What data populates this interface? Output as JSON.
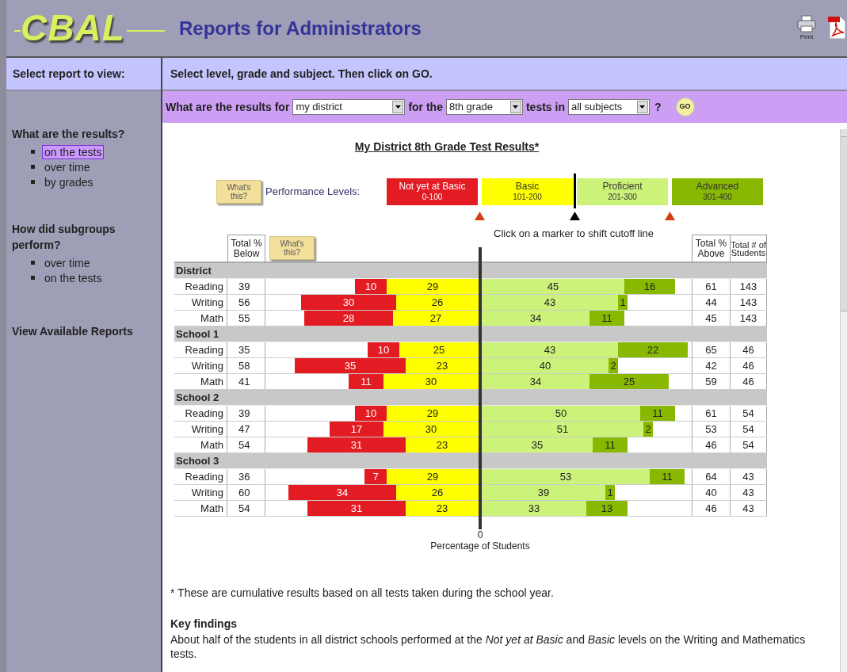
{
  "header": {
    "logo": "CBAL",
    "title": "Reports for Administrators",
    "print_label": "Print"
  },
  "sidebar": {
    "heading": "Select report to view:",
    "sections": [
      {
        "title": "What are the results?",
        "items": [
          {
            "label": "on the tests",
            "selected": true
          },
          {
            "label": "over time",
            "selected": false
          },
          {
            "label": "by grades",
            "selected": false
          }
        ]
      },
      {
        "title": "How did subgroups perform?",
        "items": [
          {
            "label": "over time",
            "selected": false
          },
          {
            "label": "on the tests",
            "selected": false
          }
        ]
      }
    ],
    "link": "View Available Reports"
  },
  "instruction": "Select level, grade and subject. Then click on GO.",
  "query": {
    "lead": "What are the results for",
    "level": "my district",
    "join_1": "for the",
    "grade": "8th grade",
    "join_2": "tests in",
    "subject": "all subjects",
    "end": "?",
    "go": "GO"
  },
  "report": {
    "title": "My District 8th Grade Test Results*",
    "whats_this": "What's this?",
    "levels_label": "Performance Levels:",
    "levels": [
      {
        "name": "Not yet at Basic",
        "range": "0-100",
        "color": "#e31b23"
      },
      {
        "name": "Basic",
        "range": "101-200",
        "color": "#ffff00"
      },
      {
        "name": "Proficient",
        "range": "201-300",
        "color": "#ccf27a"
      },
      {
        "name": "Advanced",
        "range": "301-400",
        "color": "#88b800"
      }
    ],
    "markers": [
      {
        "selected": false
      },
      {
        "selected": true
      },
      {
        "selected": false
      }
    ],
    "marker_hint": "Click on a marker to shift cutoff line",
    "columns": {
      "below": "Total % Below",
      "whats_this": "What's this?",
      "above": "Total % Above",
      "students": "Total # of Students"
    },
    "groups": [
      {
        "name": "District",
        "rows": [
          {
            "subject": "Reading",
            "below": "39",
            "segments": [
              "10",
              "29",
              "45",
              "16"
            ],
            "above": "61",
            "students": "143"
          },
          {
            "subject": "Writing",
            "below": "56",
            "segments": [
              "30",
              "26",
              "43",
              "1"
            ],
            "above": "44",
            "students": "143"
          },
          {
            "subject": "Math",
            "below": "55",
            "segments": [
              "28",
              "27",
              "34",
              "11"
            ],
            "above": "45",
            "students": "143"
          }
        ]
      },
      {
        "name": "School 1",
        "rows": [
          {
            "subject": "Reading",
            "below": "35",
            "segments": [
              "10",
              "25",
              "43",
              "22"
            ],
            "above": "65",
            "students": "46"
          },
          {
            "subject": "Writing",
            "below": "58",
            "segments": [
              "35",
              "23",
              "40",
              "2"
            ],
            "above": "42",
            "students": "46"
          },
          {
            "subject": "Math",
            "below": "41",
            "segments": [
              "11",
              "30",
              "34",
              "25"
            ],
            "above": "59",
            "students": "46"
          }
        ]
      },
      {
        "name": "School 2",
        "rows": [
          {
            "subject": "Reading",
            "below": "39",
            "segments": [
              "10",
              "29",
              "50",
              "11"
            ],
            "above": "61",
            "students": "54"
          },
          {
            "subject": "Writing",
            "below": "47",
            "segments": [
              "17",
              "30",
              "51",
              "2"
            ],
            "above": "53",
            "students": "54"
          },
          {
            "subject": "Math",
            "below": "54",
            "segments": [
              "31",
              "23",
              "35",
              "11"
            ],
            "above": "46",
            "students": "54"
          }
        ]
      },
      {
        "name": "School 3",
        "rows": [
          {
            "subject": "Reading",
            "below": "36",
            "segments": [
              "7",
              "29",
              "53",
              "11"
            ],
            "above": "64",
            "students": "43"
          },
          {
            "subject": "Writing",
            "below": "60",
            "segments": [
              "34",
              "26",
              "39",
              "1"
            ],
            "above": "40",
            "students": "43"
          },
          {
            "subject": "Math",
            "below": "54",
            "segments": [
              "31",
              "23",
              "33",
              "13"
            ],
            "above": "46",
            "students": "43"
          }
        ]
      }
    ],
    "axis_zero": "0",
    "axis_label": "Percentage of Students",
    "footnote": "* These are cumulative results based on all tests taken during the school year.",
    "key_findings": {
      "title": "Key findings",
      "text": "About half of the students in all district schools performed at the *Not yet at Basic* and *Basic* levels on the Writing and Mathematics tests."
    }
  }
}
